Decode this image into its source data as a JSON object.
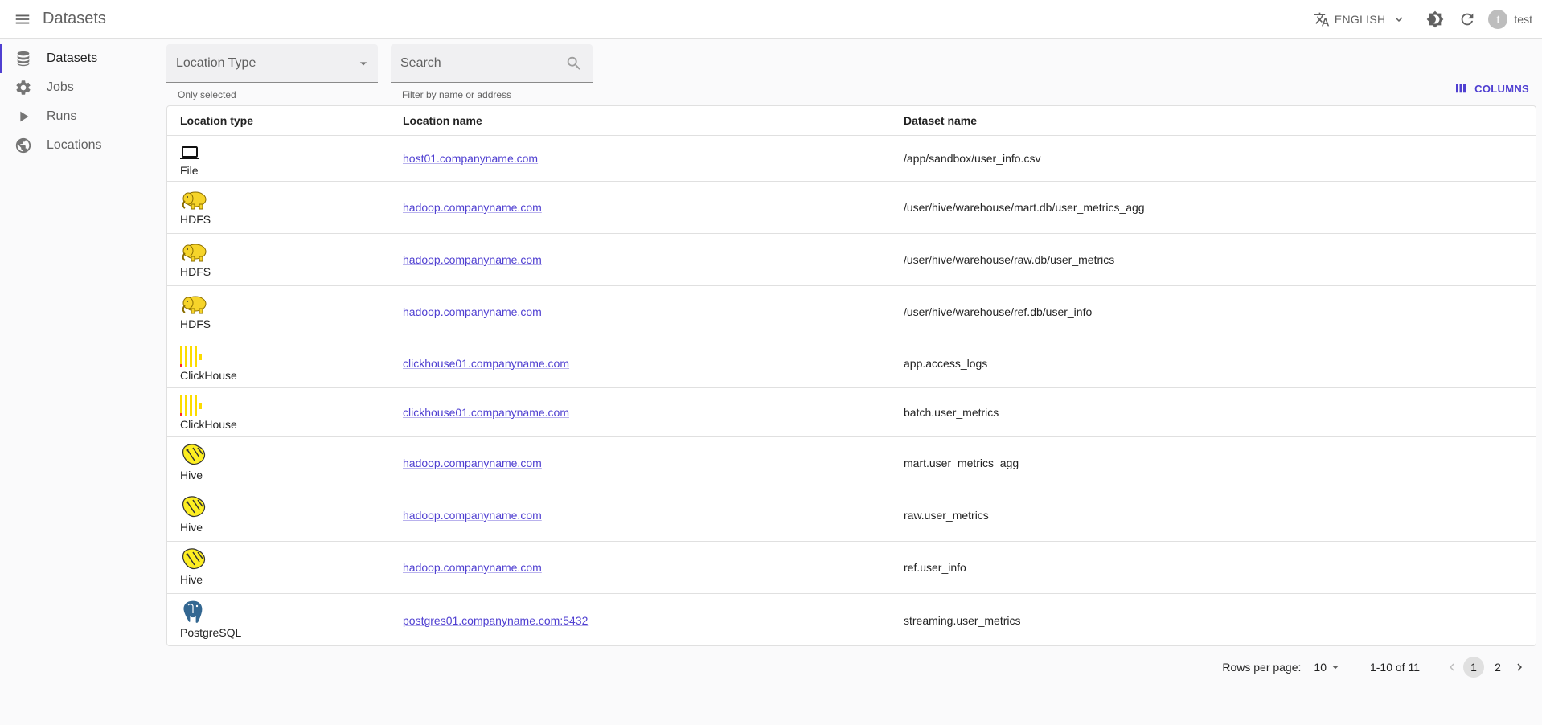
{
  "appbar": {
    "title": "Datasets",
    "language": "ENGLISH",
    "user_initial": "t",
    "username": "test"
  },
  "sidebar": {
    "items": [
      {
        "label": "Datasets",
        "icon": "database-icon",
        "active": true
      },
      {
        "label": "Jobs",
        "icon": "gear-icon"
      },
      {
        "label": "Runs",
        "icon": "play-icon"
      },
      {
        "label": "Locations",
        "icon": "globe-icon"
      }
    ]
  },
  "filters": {
    "location_type": {
      "placeholder": "Location Type",
      "helper": "Only selected"
    },
    "search": {
      "placeholder": "Search",
      "helper": "Filter by name or address"
    }
  },
  "columns_button": "COLUMNS",
  "table": {
    "headers": [
      "Location type",
      "Location name",
      "Dataset name"
    ],
    "rows": [
      {
        "type": "File",
        "icon": "laptop-icon",
        "location": "host01.companyname.com",
        "dataset": "/app/sandbox/user_info.csv"
      },
      {
        "type": "HDFS",
        "icon": "hadoop-elephant-icon",
        "location": "hadoop.companyname.com",
        "dataset": "/user/hive/warehouse/mart.db/user_metrics_agg"
      },
      {
        "type": "HDFS",
        "icon": "hadoop-elephant-icon",
        "location": "hadoop.companyname.com",
        "dataset": "/user/hive/warehouse/raw.db/user_metrics"
      },
      {
        "type": "HDFS",
        "icon": "hadoop-elephant-icon",
        "location": "hadoop.companyname.com",
        "dataset": "/user/hive/warehouse/ref.db/user_info"
      },
      {
        "type": "ClickHouse",
        "icon": "clickhouse-icon",
        "location": "clickhouse01.companyname.com",
        "dataset": "app.access_logs"
      },
      {
        "type": "ClickHouse",
        "icon": "clickhouse-icon",
        "location": "clickhouse01.companyname.com",
        "dataset": "batch.user_metrics"
      },
      {
        "type": "Hive",
        "icon": "hive-bee-icon",
        "location": "hadoop.companyname.com",
        "dataset": "mart.user_metrics_agg"
      },
      {
        "type": "Hive",
        "icon": "hive-bee-icon",
        "location": "hadoop.companyname.com",
        "dataset": "raw.user_metrics"
      },
      {
        "type": "Hive",
        "icon": "hive-bee-icon",
        "location": "hadoop.companyname.com",
        "dataset": "ref.user_info"
      },
      {
        "type": "PostgreSQL",
        "icon": "postgresql-elephant-icon",
        "location": "postgres01.companyname.com:5432",
        "dataset": "streaming.user_metrics"
      }
    ]
  },
  "pagination": {
    "rows_per_page_label": "Rows per page:",
    "rows_per_page": "10",
    "range": "1-10 of 11",
    "pages": [
      "1",
      "2"
    ],
    "current_page": "1"
  },
  "colors": {
    "accent": "#4f3fd1",
    "link": "#4f3fd1",
    "hadoop_yellow": "#f6d42a",
    "clickhouse_yellow": "#fcdc00",
    "postgres_blue": "#336791"
  }
}
